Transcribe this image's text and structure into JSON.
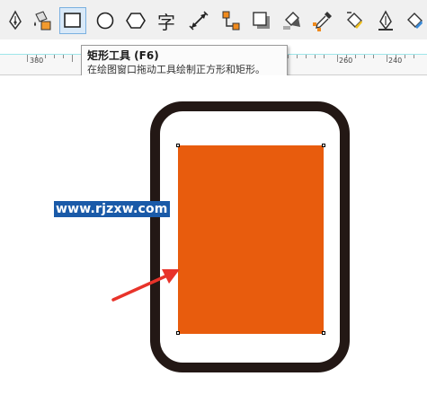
{
  "toolbar": {
    "tools": [
      {
        "icon": "pen-icon"
      },
      {
        "icon": "smart-fill-icon"
      },
      {
        "icon": "rectangle-icon",
        "active": true
      },
      {
        "icon": "ellipse-icon"
      },
      {
        "icon": "polygon-icon"
      },
      {
        "icon": "text-tool-icon",
        "glyph": "字"
      },
      {
        "icon": "dimension-icon"
      },
      {
        "icon": "connector-icon"
      },
      {
        "icon": "drop-shadow-icon"
      },
      {
        "icon": "transparency-icon"
      },
      {
        "icon": "eyedropper-icon"
      },
      {
        "icon": "interactive-fill-icon"
      },
      {
        "icon": "outline-pen-icon"
      },
      {
        "icon": "fill-icon"
      }
    ]
  },
  "ruler": {
    "labels": [
      "380",
      "260",
      "240"
    ]
  },
  "tooltip": {
    "title": "矩形工具 (F6)",
    "description": "在绘图窗口拖动工具绘制正方形和矩形。"
  },
  "canvas": {
    "watermark": "www.rjzxw.com",
    "colors": {
      "frame": "#231815",
      "rectangle_fill": "#e85c0d",
      "arrow": "#e8332a"
    }
  }
}
